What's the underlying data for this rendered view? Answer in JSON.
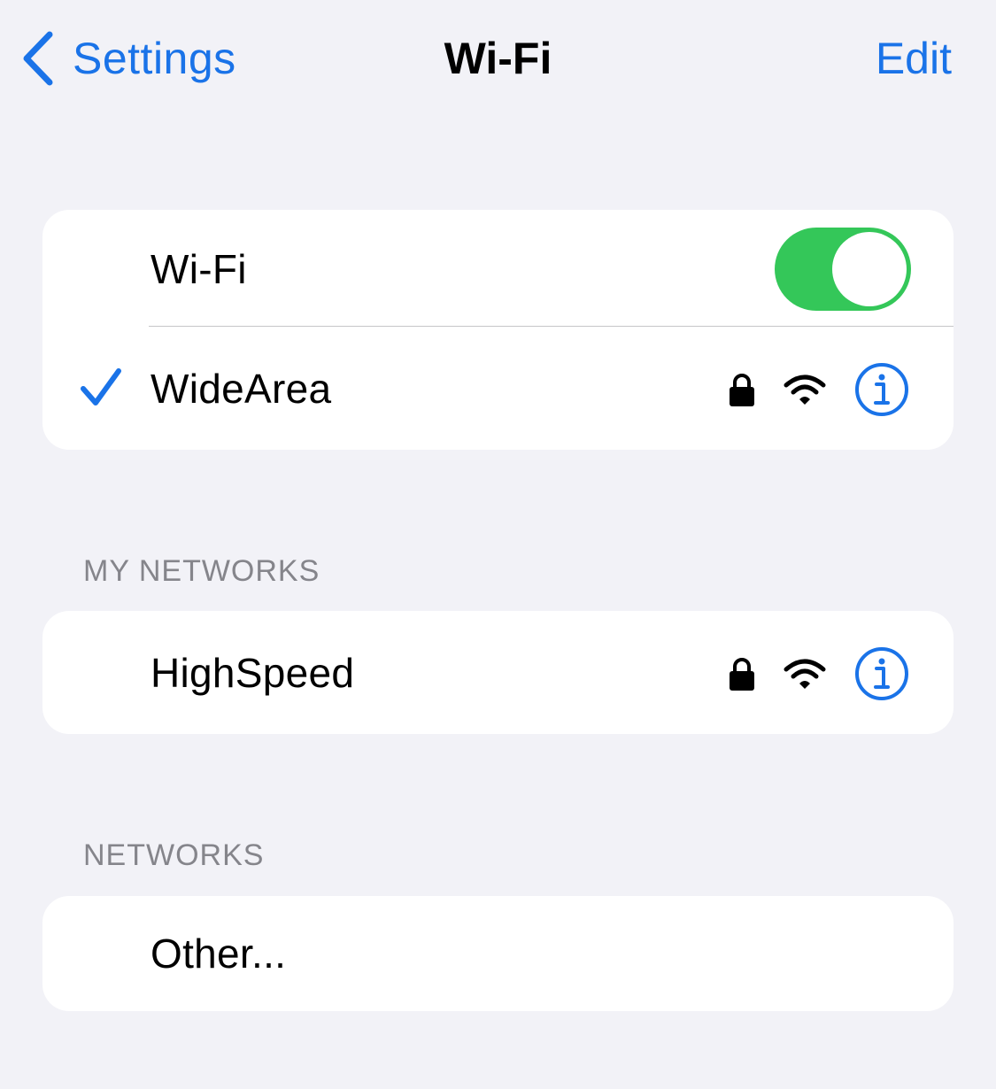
{
  "nav": {
    "back_label": "Settings",
    "title": "Wi-Fi",
    "edit_label": "Edit"
  },
  "wifi_group": {
    "toggle_label": "Wi-Fi",
    "toggle_on": true,
    "connected_network": {
      "name": "WideArea",
      "secured": true,
      "selected": true
    }
  },
  "my_networks": {
    "header": "MY NETWORKS",
    "items": [
      {
        "name": "HighSpeed",
        "secured": true
      }
    ]
  },
  "networks": {
    "header": "NETWORKS",
    "items": [
      {
        "name": "Other..."
      }
    ]
  },
  "icons": {
    "back": "chevron-left-icon",
    "check": "checkmark-icon",
    "lock": "lock-icon",
    "wifi": "wifi-signal-icon",
    "info": "info-icon"
  },
  "colors": {
    "background": "#f2f2f7",
    "accent": "#1a73e8",
    "toggle_on": "#34c759",
    "section_header": "#85858b"
  }
}
